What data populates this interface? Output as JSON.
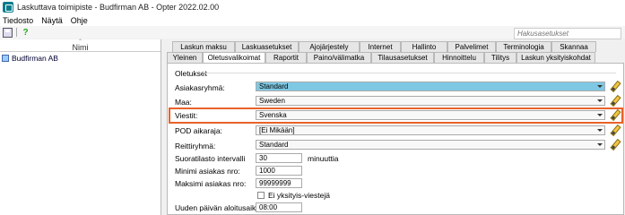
{
  "window": {
    "title": "Laskuttava toimipiste - Budfirman AB - Opter 2022.02.00"
  },
  "menu": {
    "items": [
      "Tiedosto",
      "Näytä",
      "Ohje"
    ]
  },
  "toolbar": {
    "save_icon": "save-icon",
    "help_icon": "help-icon"
  },
  "search": {
    "placeholder": "Hakusasetukset"
  },
  "left_pane": {
    "column_header": "Nimi",
    "items": [
      {
        "label": "Budfirman AB",
        "icon": "tree-item-icon"
      }
    ]
  },
  "tabs_row1": [
    "Laskun maksu",
    "Laskuasetukset",
    "Ajojärjestely",
    "Internet",
    "Hallinto",
    "Palvelimet",
    "Terminologia",
    "Skannaa"
  ],
  "tabs_row2": [
    "Yleinen",
    "Oletusvalikoimat",
    "Raportit",
    "Paino/välimatka",
    "Tilausasetukset",
    "Hinnoittelu",
    "Tilitys",
    "Laskun yksityiskohdat"
  ],
  "active_tab": "Oletusvalikoimat",
  "form": {
    "group_title": "Oletukset",
    "asiakasryhma": {
      "label": "Asiakasryhmä:",
      "value": "Standard"
    },
    "maa": {
      "label": "Maa:",
      "value": "Sweden"
    },
    "viestit": {
      "label": "Viestit:",
      "value": "Svenska"
    },
    "pod": {
      "label": "POD aikaraja:",
      "value": "[Ei Mikään]"
    },
    "reittiryhma": {
      "label": "Reittiryhmä:",
      "value": "Standard"
    },
    "suoratilasto": {
      "label": "Suoratilasto intervalli",
      "value": "30",
      "unit": "minuuttia"
    },
    "minimi": {
      "label": "Minimi asiakas nro:",
      "value": "1000"
    },
    "maksimi": {
      "label": "Maksimi asiakas nro:",
      "value": "99999999"
    },
    "yksityis": {
      "label": "Ei yksityis-viestejä",
      "checked": false
    },
    "uuden_paivan": {
      "label": "Uuden päivän aloitusaika:",
      "value": "08:00"
    }
  },
  "colors": {
    "highlight": "#e8622a",
    "combo_blue": "#7ec8e3"
  }
}
